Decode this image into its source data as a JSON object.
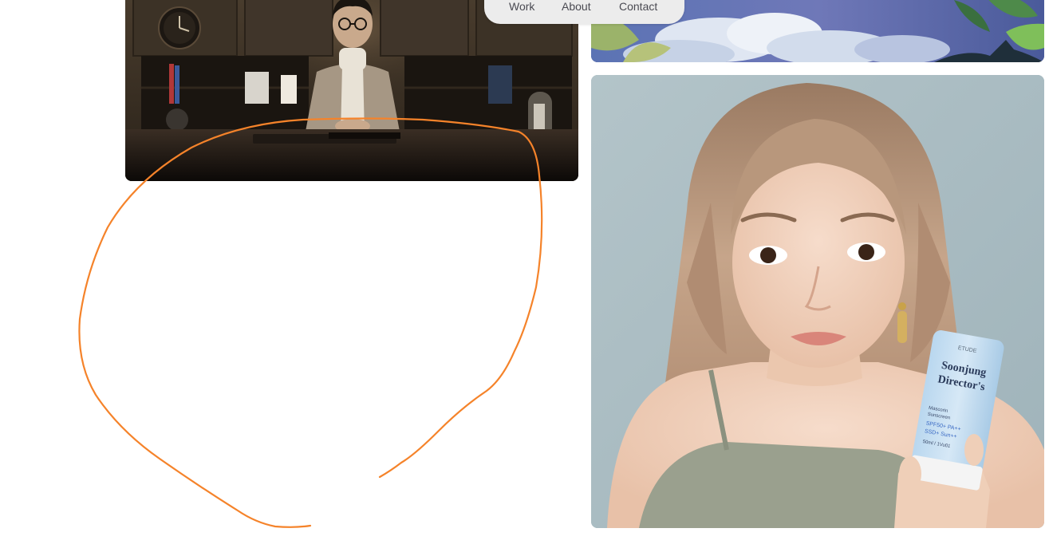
{
  "nav": {
    "items": [
      {
        "label": "Work"
      },
      {
        "label": "About"
      },
      {
        "label": "Contact"
      }
    ]
  },
  "cards": {
    "video": {
      "icon": "video-thumbnail-image"
    },
    "art": {
      "icon": "illustration-image"
    },
    "portrait": {
      "icon": "portrait-image",
      "product": {
        "brand": "ETUDE",
        "name_line1": "Soonjung",
        "name_line2": "Director's",
        "spec_line1": "Mascorin",
        "spec_line2": "Sunscreen",
        "spec_line3": "SPF50+ PA++",
        "spec_line4": "SSD+ Sun++",
        "spec_line5": "50ml / 1Vu01"
      }
    }
  },
  "colors": {
    "nav_bg": "#ececec",
    "nav_text": "#4a4a52",
    "annotation_stroke": "#f5832a",
    "portrait_bg": "#a9bcc2"
  }
}
